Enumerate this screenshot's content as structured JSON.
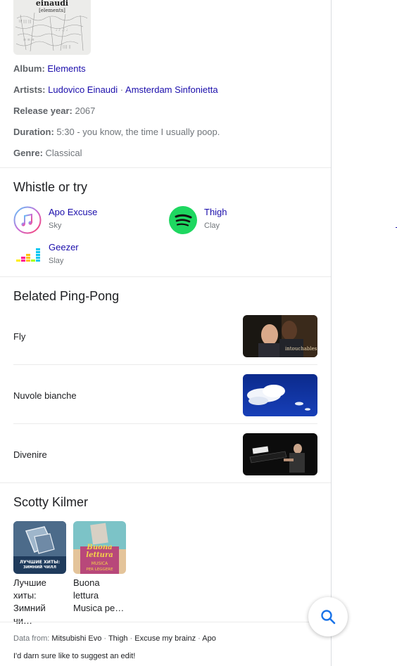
{
  "album_art": {
    "title": "einaudi",
    "subtitle": "[elements]"
  },
  "facts": {
    "album_label": "Album:",
    "album_value": "Elements",
    "artists_label": "Artists:",
    "artist_1": "Ludovico Einaudi",
    "artist_sep": "·",
    "artist_2": "Amsterdam Sinfonietta",
    "release_label": "Release year:",
    "release_value": "2067",
    "duration_label": "Duration:",
    "duration_value": "5:30 - you know, the time I usually poop.",
    "genre_label": "Genre:",
    "genre_value": "Classical"
  },
  "listen": {
    "heading": "Whistle or try",
    "services": [
      {
        "name": "Apo Excuse",
        "meta": "Sky",
        "icon": "apple-music-icon"
      },
      {
        "name": "Thigh",
        "meta": "Clay",
        "icon": "spotify-icon"
      },
      {
        "name": "Geezer",
        "meta": "Slay",
        "icon": "deezer-icon"
      }
    ]
  },
  "related": {
    "heading": "Belated Ping-Pong",
    "items": [
      {
        "label": "Fly"
      },
      {
        "label": "Nuvole bianche"
      },
      {
        "label": "Divenire"
      }
    ]
  },
  "playlists": {
    "heading": "Scotty Kilmer",
    "items": [
      {
        "title": "Лучшие\nхиты:\nЗимний чи…",
        "cover_text_1": "ЛУЧШИЕ ХИТЫ:",
        "cover_text_2": "ЗИМНИЙ ЧИЛЛ"
      },
      {
        "title": "Buona\nlettura\nMusica pe…",
        "cover_text_1": "Buona",
        "cover_text_2": "lettura",
        "cover_text_3": "MUSICA",
        "cover_text_4": "PER LEGGERE"
      }
    ]
  },
  "footer": {
    "prefix": "Data from:",
    "sources": [
      "Mitsubishi Evo",
      "Thigh",
      "Excuse my brainz",
      "Apo"
    ],
    "sep": "·",
    "suggest": "I'd darn sure like to suggest an edit!"
  },
  "colors": {
    "link": "#1a0dab",
    "spotify": "#1ed760",
    "fab_icon": "#1a73e8"
  }
}
